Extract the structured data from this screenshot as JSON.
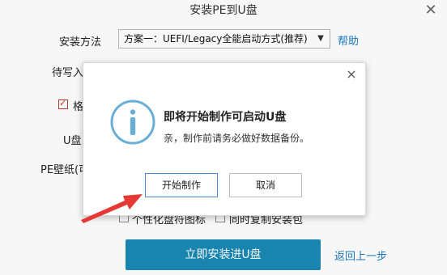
{
  "window": {
    "title": "安装PE到U盘",
    "close_glyph": "✕"
  },
  "form": {
    "install_method_label": "安装方法",
    "install_method_value": "方案一：UEFI/Legacy全能启动方式(推荐)",
    "help_label": "帮助",
    "pending_label_partial": "待写入",
    "format_checkbox_partial": "格",
    "udisk_label_partial": "U盘",
    "wallpaper_label_partial": "PE壁纸(可",
    "personalize_checkbox_label": "个性化盘符图标",
    "copy_package_checkbox_label": "同时复制安装包"
  },
  "actions": {
    "install_button": "立即安装进U盘",
    "back_link": "返回上一步"
  },
  "dialog": {
    "close_glyph": "×",
    "title": "即将开始制作可启动U盘",
    "message": "亲，制作前请务必做好数据备份。",
    "start_button": "开始制作",
    "cancel_button": "取消"
  },
  "colors": {
    "primary": "#1a8ab5",
    "link": "#1a7bc4",
    "info_icon": "#6aaed6",
    "arrow": "#e53935",
    "checkbox_check": "#c0392b"
  },
  "icons": {
    "info": "info-circle-icon",
    "dropdown": "chevron-down-icon",
    "arrow": "annotation-arrow"
  }
}
